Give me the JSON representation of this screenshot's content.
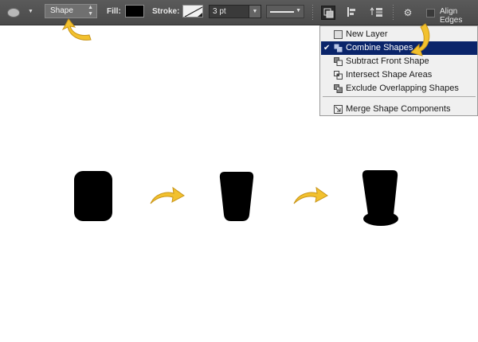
{
  "optionsBar": {
    "mode_label": "Shape",
    "fill_label": "Fill:",
    "fill_color": "#000000",
    "stroke_label": "Stroke:",
    "stroke_width": "3 pt",
    "align_edges_label": "Align Edges",
    "icons": {
      "tool": "ellipse-tool-icon",
      "path_ops": "path-operations-icon",
      "path_align": "path-alignment-icon",
      "path_arrange": "path-arrangement-icon",
      "settings": "gear-icon"
    }
  },
  "menu": {
    "items": [
      {
        "label": "New Layer",
        "icon": "new-layer-icon",
        "checked": false,
        "selected": false
      },
      {
        "label": "Combine Shapes",
        "icon": "combine-shapes-icon",
        "checked": true,
        "selected": true
      },
      {
        "label": "Subtract Front Shape",
        "icon": "subtract-front-shape-icon",
        "checked": false,
        "selected": false
      },
      {
        "label": "Intersect Shape Areas",
        "icon": "intersect-shape-areas-icon",
        "checked": false,
        "selected": false
      },
      {
        "label": "Exclude Overlapping Shapes",
        "icon": "exclude-overlapping-shapes-icon",
        "checked": false,
        "selected": false
      },
      {
        "label": "Merge Shape Components",
        "icon": "merge-shape-components-icon",
        "checked": false,
        "selected": false
      }
    ],
    "highlight_color": "#0a246a"
  },
  "canvas": {
    "shape_color": "#000000",
    "arrow_color": "#f2c12e"
  }
}
